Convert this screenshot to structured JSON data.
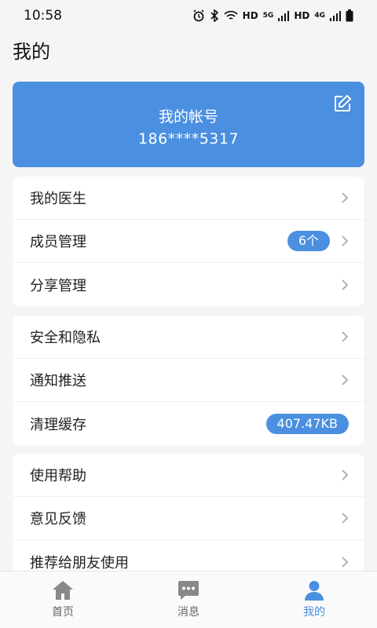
{
  "status_bar": {
    "time": "10:58",
    "icons": [
      "alarm-icon",
      "bluetooth-icon",
      "wifi-icon",
      "hd-icon",
      "signal-5g-icon",
      "hd-icon",
      "signal-4g-icon",
      "battery-icon"
    ],
    "hd_label": "HD",
    "net5g_label": "5G",
    "net4g_label": "4G"
  },
  "page_title": "我的",
  "account": {
    "title": "我的帐号",
    "phone": "186****5317",
    "edit_icon": "edit-icon"
  },
  "groups": [
    {
      "items": [
        {
          "label": "我的医生"
        },
        {
          "label": "成员管理",
          "badge": "6个"
        },
        {
          "label": "分享管理"
        }
      ]
    },
    {
      "items": [
        {
          "label": "安全和隐私"
        },
        {
          "label": "通知推送"
        },
        {
          "label": "清理缓存",
          "badge": "407.47KB"
        }
      ]
    },
    {
      "items": [
        {
          "label": "使用帮助"
        },
        {
          "label": "意见反馈"
        },
        {
          "label": "推荐给朋友使用"
        }
      ]
    }
  ],
  "tab_bar": {
    "tabs": [
      {
        "label": "首页",
        "icon": "home-icon"
      },
      {
        "label": "消息",
        "icon": "message-icon"
      },
      {
        "label": "我的",
        "icon": "user-icon",
        "active": true
      }
    ]
  },
  "colors": {
    "accent": "#4a8fe0",
    "background": "#f5f5f5",
    "card": "#ffffff"
  }
}
